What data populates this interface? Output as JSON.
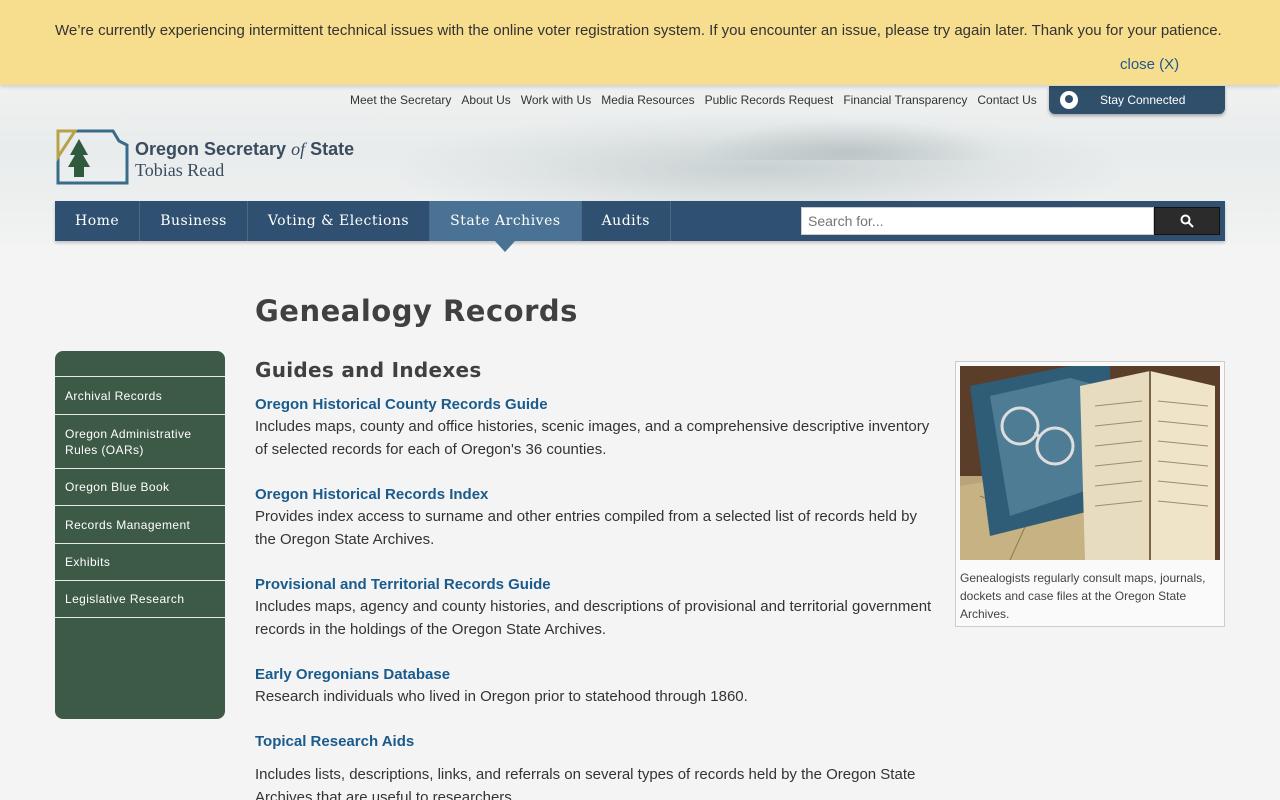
{
  "alert": {
    "message": "We’re currently experiencing intermittent technical issues with the online voter registration system. If you encounter an issue, please try again later. Thank you for your patience.",
    "close_label": "close (X)"
  },
  "utility_nav": [
    "Meet the Secretary",
    "About Us",
    "Work with Us",
    "Media Resources",
    "Public Records Request",
    "Financial Transparency",
    "Contact Us"
  ],
  "stay_connected": "Stay Connected",
  "logo": {
    "title_prefix": "Oregon Secretary ",
    "title_of": "of",
    "title_suffix": " State",
    "subtitle": "Tobias Read"
  },
  "main_nav": [
    "Home",
    "Business",
    "Voting & Elections",
    "State Archives",
    "Audits"
  ],
  "search": {
    "placeholder": "Search for..."
  },
  "sidebar": [
    "Archival Records",
    "Oregon Administrative Rules (OARs)",
    "Oregon Blue Book",
    "Records Management",
    "Exhibits",
    "Legislative Research"
  ],
  "page_title": "Genealogy Records",
  "section_title": "Guides and Indexes",
  "entries": [
    {
      "title": "Oregon Historical County Records Guide",
      "description": "Includes maps, county and office histories, scenic images, and a comprehensive descriptive inventory of selected records for each of Oregon's 36 counties."
    },
    {
      "title": "Oregon Historical Records Index",
      "description": "Provides index access to surname and other entries compiled from a selected list of records held by the Oregon State Archives."
    },
    {
      "title": "Provisional and Territorial Records Guide",
      "description": "Includes maps, agency and county histories, and descriptions of provisional and territorial government records in the holdings of the Oregon State Archives."
    },
    {
      "title": "Early Oregonians Database",
      "description": "Research individuals who lived in Oregon prior to statehood through 1860."
    },
    {
      "title": "Topical Research Aids",
      "description": "Includes lists, descriptions, links, and referrals on several types of records held by the Oregon State Archives that are useful to researchers."
    }
  ],
  "figure": {
    "caption": "Genealogists regularly consult maps, journals, dockets and case files at the Oregon State Archives."
  },
  "colors": {
    "alert_bg": "#f7dd8e",
    "nav_bg": "#2f5070",
    "nav_active": "#4a7294",
    "sidebar_bg": "#3d5a46",
    "link": "#1a5b8c"
  }
}
